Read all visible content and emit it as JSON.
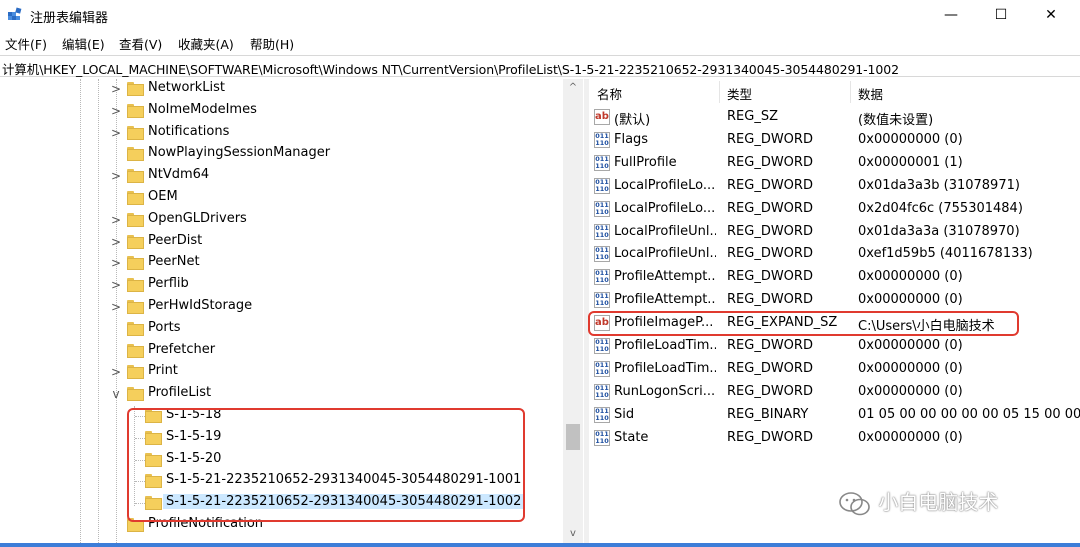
{
  "window": {
    "title": "注册表编辑器",
    "minimize_glyph": "—",
    "maximize_glyph": "☐",
    "close_glyph": "✕"
  },
  "menu": [
    "文件(F)",
    "编辑(E)",
    "查看(V)",
    "收藏夹(A)",
    "帮助(H)"
  ],
  "address": "计算机\\HKEY_LOCAL_MACHINE\\SOFTWARE\\Microsoft\\Windows NT\\CurrentVersion\\ProfileList\\S-1-5-21-2235210652-2931340045-3054480291-1002",
  "tree": [
    {
      "label": "NetworkList",
      "expander": ">"
    },
    {
      "label": "NoImeModeImes",
      "expander": ">"
    },
    {
      "label": "Notifications",
      "expander": ">"
    },
    {
      "label": "NowPlayingSessionManager",
      "expander": ""
    },
    {
      "label": "NtVdm64",
      "expander": ">"
    },
    {
      "label": "OEM",
      "expander": ""
    },
    {
      "label": "OpenGLDrivers",
      "expander": ">"
    },
    {
      "label": "PeerDist",
      "expander": ">"
    },
    {
      "label": "PeerNet",
      "expander": ">"
    },
    {
      "label": "Perflib",
      "expander": ">"
    },
    {
      "label": "PerHwIdStorage",
      "expander": ">"
    },
    {
      "label": "Ports",
      "expander": ""
    },
    {
      "label": "Prefetcher",
      "expander": ""
    },
    {
      "label": "Print",
      "expander": ">"
    },
    {
      "label": "ProfileList",
      "expander": "v"
    },
    {
      "label": "S-1-5-18",
      "expander": ""
    },
    {
      "label": "S-1-5-19",
      "expander": ""
    },
    {
      "label": "S-1-5-20",
      "expander": ""
    },
    {
      "label": "S-1-5-21-2235210652-2931340045-3054480291-1001",
      "expander": ""
    },
    {
      "label": "S-1-5-21-2235210652-2931340045-3054480291-1002",
      "expander": ""
    },
    {
      "label": "ProfileNotification",
      "expander": ""
    }
  ],
  "scrollbar": {
    "up": "^",
    "down": "v"
  },
  "values_header": {
    "name": "名称",
    "type": "类型",
    "data": "数据"
  },
  "values": [
    {
      "icon": "string-value-icon",
      "name": "(默认)",
      "type": "REG_SZ",
      "data": "(数值未设置)"
    },
    {
      "icon": "binary-value-icon",
      "name": "Flags",
      "type": "REG_DWORD",
      "data": "0x00000000 (0)"
    },
    {
      "icon": "binary-value-icon",
      "name": "FullProfile",
      "type": "REG_DWORD",
      "data": "0x00000001 (1)"
    },
    {
      "icon": "binary-value-icon",
      "name": "LocalProfileLo...",
      "type": "REG_DWORD",
      "data": "0x01da3a3b (31078971)"
    },
    {
      "icon": "binary-value-icon",
      "name": "LocalProfileLo...",
      "type": "REG_DWORD",
      "data": "0x2d04fc6c (755301484)"
    },
    {
      "icon": "binary-value-icon",
      "name": "LocalProfileUnl...",
      "type": "REG_DWORD",
      "data": "0x01da3a3a (31078970)"
    },
    {
      "icon": "binary-value-icon",
      "name": "LocalProfileUnl...",
      "type": "REG_DWORD",
      "data": "0xef1d59b5 (4011678133)"
    },
    {
      "icon": "binary-value-icon",
      "name": "ProfileAttempt...",
      "type": "REG_DWORD",
      "data": "0x00000000 (0)"
    },
    {
      "icon": "binary-value-icon",
      "name": "ProfileAttempt...",
      "type": "REG_DWORD",
      "data": "0x00000000 (0)"
    },
    {
      "icon": "string-value-icon",
      "name": "ProfileImageP...",
      "type": "REG_EXPAND_SZ",
      "data": "C:\\Users\\小白电脑技术"
    },
    {
      "icon": "binary-value-icon",
      "name": "ProfileLoadTim...",
      "type": "REG_DWORD",
      "data": "0x00000000 (0)"
    },
    {
      "icon": "binary-value-icon",
      "name": "ProfileLoadTim...",
      "type": "REG_DWORD",
      "data": "0x00000000 (0)"
    },
    {
      "icon": "binary-value-icon",
      "name": "RunLogonScri...",
      "type": "REG_DWORD",
      "data": "0x00000000 (0)"
    },
    {
      "icon": "binary-value-icon",
      "name": "Sid",
      "type": "REG_BINARY",
      "data": "01 05 00 00 00 00 00 05 15 00 00 0"
    },
    {
      "icon": "binary-value-icon",
      "name": "State",
      "type": "REG_DWORD",
      "data": "0x00000000 (0)"
    }
  ],
  "icon_text": {
    "string": "ab",
    "binary": "011 110"
  },
  "watermark": "小白电脑技术",
  "colors": {
    "highlight_box": "#e03a2f",
    "selection": "#cce8ff",
    "folder": "#f5cf5c"
  }
}
